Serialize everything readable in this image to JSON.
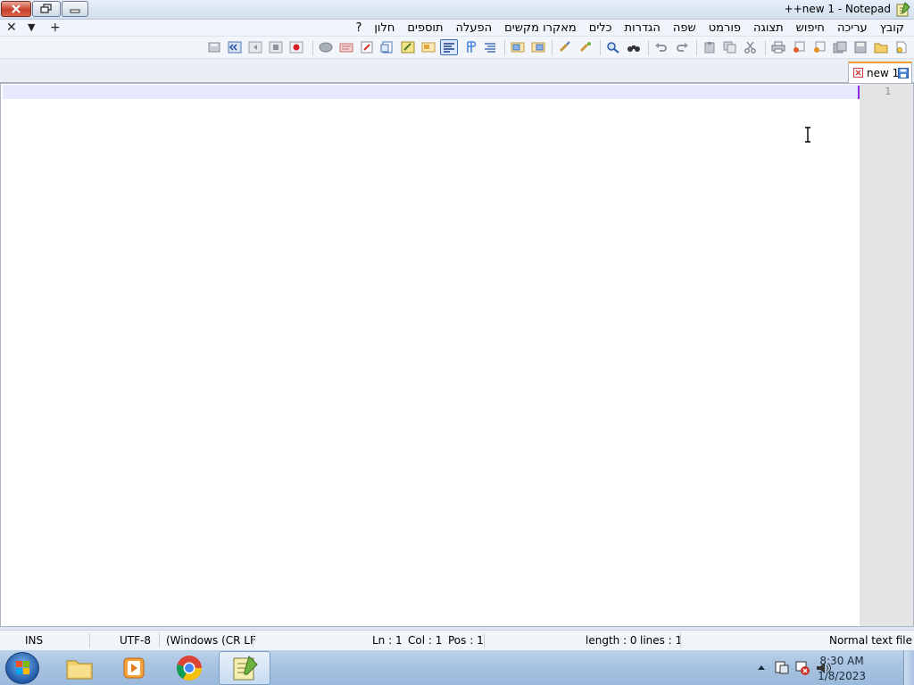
{
  "window": {
    "title": "++new 1 - Notepad",
    "controls": {
      "close": "close",
      "maximize": "restore",
      "minimize": "minimize"
    }
  },
  "menubar": {
    "items": [
      "קובץ",
      "עריכה",
      "חיפוש",
      "תצוגה",
      "פורמט",
      "שפה",
      "הגדרות",
      "כלים",
      "מאקרו מקשים",
      "הפעלה",
      "תוספים",
      "חלון",
      "?"
    ],
    "left_controls": {
      "close_doc": "✕",
      "dropdown": "▼",
      "new": "+"
    }
  },
  "toolbar": {
    "icons": [
      "new-file-icon",
      "open-file-icon",
      "save-icon",
      "save-all-icon",
      "close-icon",
      "close-all-icon",
      "print-icon",
      "cut-icon",
      "copy-icon",
      "paste-icon",
      "undo-icon",
      "redo-icon",
      "find-icon",
      "replace-icon",
      "zoom-in-icon",
      "zoom-out-icon",
      "sync-v-icon",
      "sync-h-icon",
      "wrap-icon",
      "show-all-icon",
      "indent-guide-icon",
      "doc-map-icon",
      "function-list-icon",
      "folder-workspace-icon",
      "doc-list-icon",
      "monitor-icon",
      "record-icon",
      "stop-icon",
      "play-icon",
      "play-multiple-icon",
      "save-macro-icon"
    ],
    "active_icon": "doc-map-icon"
  },
  "tabs": [
    {
      "label": "new 1",
      "active": true
    }
  ],
  "editor": {
    "line_numbers": [
      "1"
    ],
    "content": ""
  },
  "statusbar": {
    "file_type": "Normal text file",
    "length": "length : 0",
    "lines": "lines : 1",
    "ln": "Ln : 1",
    "col": "Col : 1",
    "pos": "Pos : 1",
    "eol": "(Windows (CR LF",
    "encoding": "UTF-8",
    "mode": "INS"
  },
  "taskbar": {
    "apps": [
      "file-explorer-icon",
      "media-player-icon",
      "chrome-icon",
      "notepad-plus-plus-icon"
    ],
    "active_app": "notepad-plus-plus-icon",
    "clock_time": "8:30 AM",
    "clock_date": "1/8/2023"
  },
  "colors": {
    "current_line": "#e8e8ff",
    "caret": "#8a2be2",
    "tab_accent": "#f0a030"
  }
}
